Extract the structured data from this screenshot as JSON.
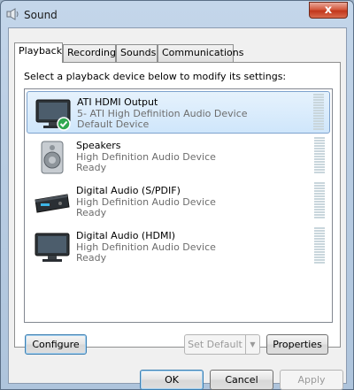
{
  "window": {
    "title": "Sound",
    "close_label": "x"
  },
  "tabs": [
    {
      "label": "Playback",
      "active": true
    },
    {
      "label": "Recording",
      "active": false
    },
    {
      "label": "Sounds",
      "active": false
    },
    {
      "label": "Communications",
      "active": false
    }
  ],
  "panel": {
    "instruction": "Select a playback device below to modify its settings:"
  },
  "devices": [
    {
      "name": "ATI HDMI Output",
      "description": "5- ATI High Definition Audio Device",
      "status": "Default Device",
      "icon": "monitor-icon",
      "selected": true,
      "default_check": true
    },
    {
      "name": "Speakers",
      "description": "High Definition Audio Device",
      "status": "Ready",
      "icon": "speaker-icon",
      "selected": false
    },
    {
      "name": "Digital Audio (S/PDIF)",
      "description": "High Definition Audio Device",
      "status": "Ready",
      "icon": "receiver-icon",
      "selected": false
    },
    {
      "name": "Digital Audio (HDMI)",
      "description": "High Definition Audio Device",
      "status": "Ready",
      "icon": "monitor-icon",
      "selected": false
    }
  ],
  "buttons": {
    "configure": "Configure",
    "set_default": "Set Default",
    "properties": "Properties",
    "ok": "OK",
    "cancel": "Cancel",
    "apply": "Apply"
  },
  "colors": {
    "selection": "#cfe6fb",
    "check": "#2fa84f"
  }
}
